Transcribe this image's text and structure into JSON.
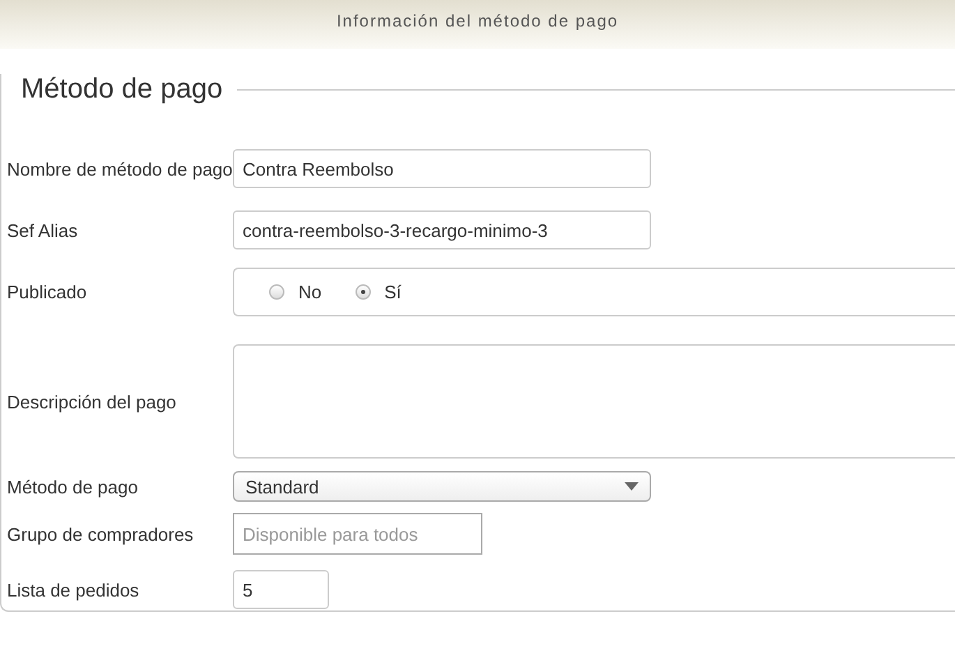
{
  "header": {
    "title": "Información del método de pago"
  },
  "fieldset": {
    "legend": "Método de pago"
  },
  "fields": [
    {
      "kind": "text",
      "label": "Nombre de método de pago",
      "value": "Contra Reembolso"
    },
    {
      "kind": "text",
      "label": "Sef Alias",
      "value": "contra-reembolso-3-recargo-minimo-3"
    },
    {
      "kind": "radio",
      "label": "Publicado",
      "options": [
        {
          "label": "No",
          "selected": false
        },
        {
          "label": "Sí",
          "selected": true
        }
      ]
    },
    {
      "kind": "textarea",
      "label": "Descripción del pago"
    },
    {
      "kind": "select",
      "label": "Método de pago",
      "value": "Standard"
    },
    {
      "kind": "group",
      "label": "Grupo de compradores",
      "placeholder": "Disponible para todos"
    },
    {
      "kind": "number",
      "label": "Lista de pedidos",
      "value": "5"
    }
  ]
}
